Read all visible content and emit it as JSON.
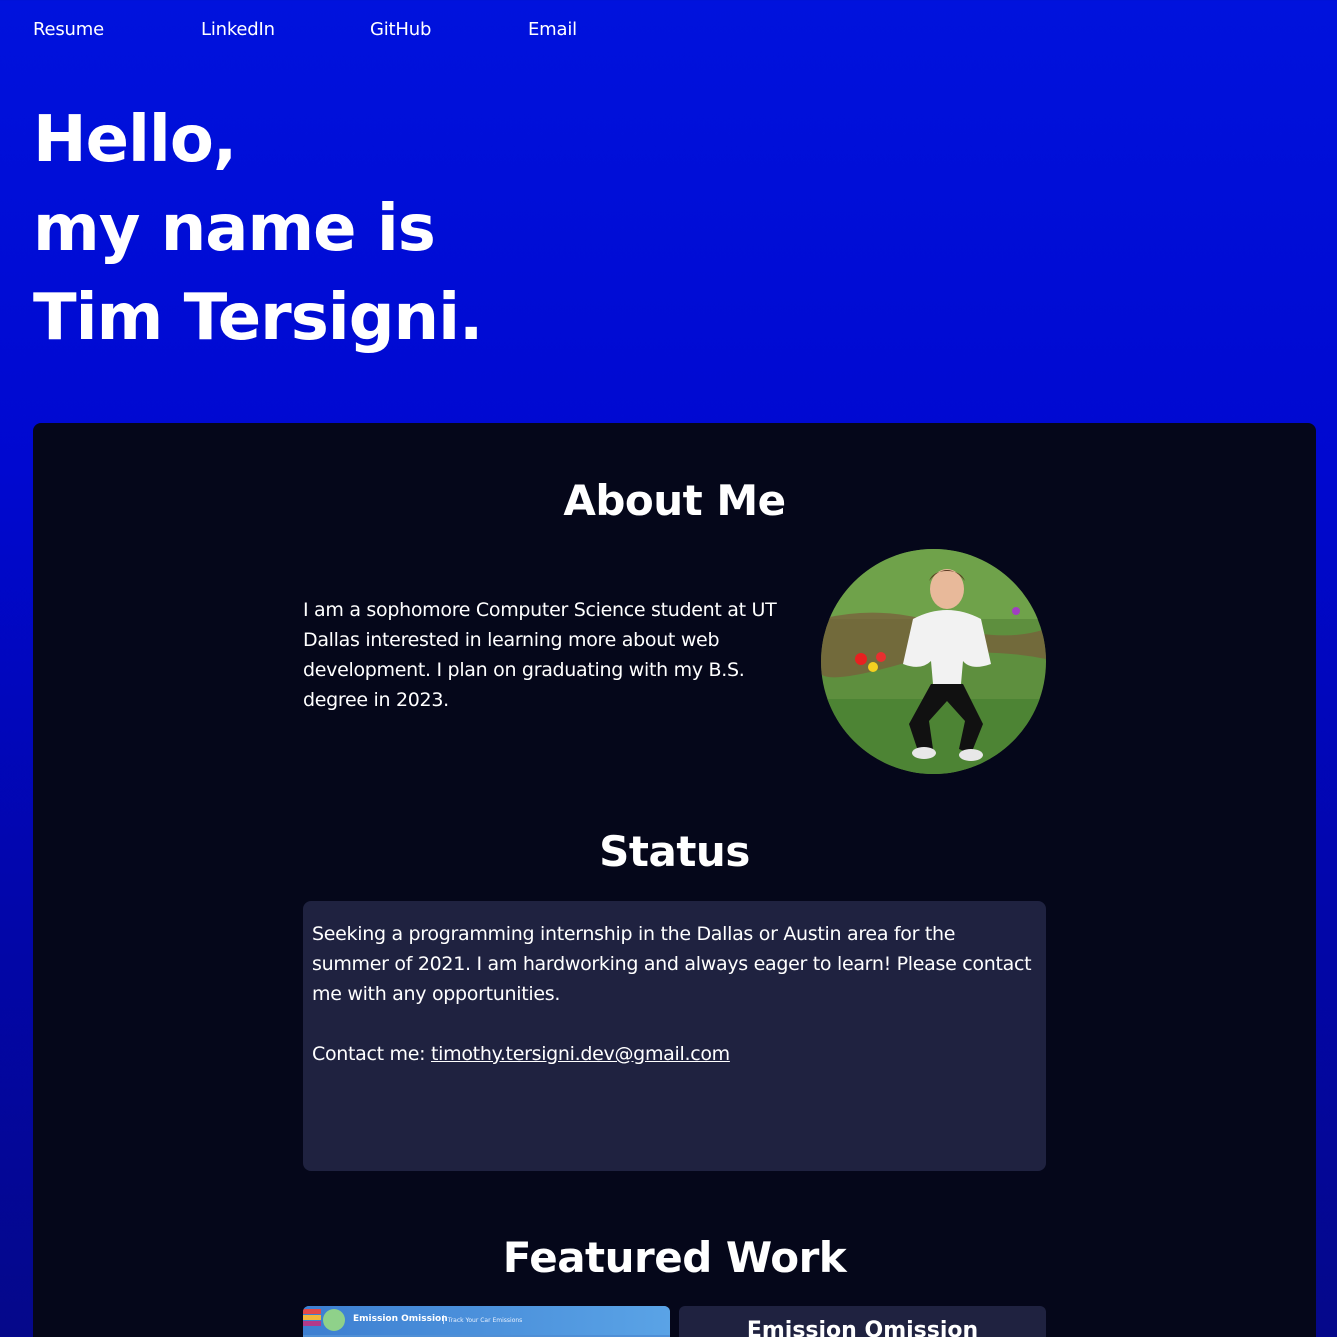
{
  "nav": {
    "items": [
      {
        "label": "Resume"
      },
      {
        "label": "LinkedIn"
      },
      {
        "label": "GitHub"
      },
      {
        "label": "Email"
      }
    ]
  },
  "hero": {
    "line1": "Hello,",
    "line2": "my name is",
    "line3": "Tim Tersigni."
  },
  "about": {
    "title": "About Me",
    "text": "I am a sophomore Computer Science student at UT Dallas interested in learning more about web development. I plan on graduating with my B.S. degree in 2023.",
    "photo_icon": "profile-photo"
  },
  "status": {
    "title": "Status",
    "text": "Seeking a programming internship in the Dallas or Austin area for the summer of 2021. I am hardworking and always eager to learn! Please contact me with any opportunities.",
    "contact_label": "Contact me:",
    "contact_email": "timothy.tersigni.dev@gmail.com"
  },
  "featured": {
    "title": "Featured Work",
    "thumb_title": "Emission Omission",
    "thumb_subtitle": "Track Your Car Emissions",
    "card_title": "Emission Omission"
  },
  "colors": {
    "background_top": "#0012dd",
    "background_bottom": "#05088a",
    "card": "#05071a",
    "status_box": "#1f2240"
  }
}
